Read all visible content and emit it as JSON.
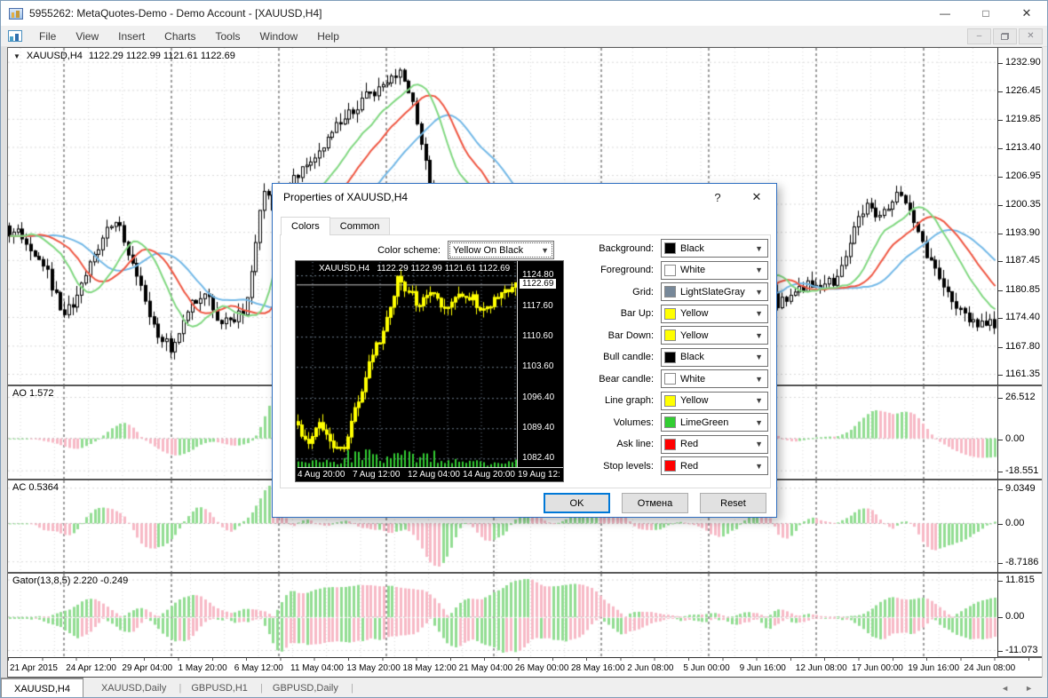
{
  "window": {
    "title": "5955262: MetaQuotes-Demo - Demo Account - [XAUUSD,H4]",
    "controls": {
      "minimize": "—",
      "maximize": "□",
      "close": "✕"
    }
  },
  "menu": {
    "items": [
      "File",
      "View",
      "Insert",
      "Charts",
      "Tools",
      "Window",
      "Help"
    ],
    "mdi": {
      "minimize": "–",
      "close": "✕"
    }
  },
  "chart": {
    "dropdown_arrow": "▼",
    "symbol_label": "XAUUSD,H4",
    "ohlc": "1122.29 1122.99 1121.61 1122.69",
    "price_ticks": [
      "1232.90",
      "1226.45",
      "1219.85",
      "1213.40",
      "1206.95",
      "1200.35",
      "1193.90",
      "1187.45",
      "1180.85",
      "1174.40",
      "1167.80",
      "1161.35"
    ],
    "time_ticks": [
      "21 Apr 2015",
      "24 Apr 12:00",
      "29 Apr 04:00",
      "1 May 20:00",
      "6 May 12:00",
      "11 May 04:00",
      "13 May 20:00",
      "18 May 12:00",
      "21 May 04:00",
      "26 May 00:00",
      "28 May 16:00",
      "2 Jun 08:00",
      "5 Jun 00:00",
      "9 Jun 16:00",
      "12 Jun 08:00",
      "17 Jun 00:00",
      "19 Jun 16:00",
      "24 Jun 08:00"
    ]
  },
  "indicators": [
    {
      "label": "AO 1.572",
      "ticks": [
        "26.512",
        "0.00",
        "-18.551"
      ]
    },
    {
      "label": "AC 0.5364",
      "ticks": [
        "9.0349",
        "0.00",
        "-8.7186"
      ]
    },
    {
      "label": "Gator(13,8,5) 2.220 -0.249",
      "ticks": [
        "11.815",
        "0.00",
        "-11.073"
      ]
    }
  ],
  "tabbar": {
    "tabs": [
      {
        "label": "XAUUSD,H4",
        "active": true
      },
      {
        "label": "XAUUSD,Daily"
      },
      {
        "label": "GBPUSD,H1"
      },
      {
        "label": "GBPUSD,Daily"
      }
    ],
    "scroll_left": "◄",
    "scroll_right": "►"
  },
  "dialog": {
    "title": "Properties of XAUUSD,H4",
    "help": "?",
    "close": "✕",
    "tabs": [
      {
        "label": "Colors",
        "active": true
      },
      {
        "label": "Common"
      }
    ],
    "color_scheme_label": "Color scheme:",
    "color_scheme_value": "Yellow On Black",
    "preview": {
      "symbol_label": "XAUUSD,H4",
      "ohlc": "1122.29 1122.99 1121.61 1122.69",
      "price_ticks": [
        {
          "v": "1124.80"
        },
        {
          "v": "1122.69",
          "current": true
        },
        {
          "v": "1117.60"
        },
        {
          "v": "1110.60"
        },
        {
          "v": "1103.60"
        },
        {
          "v": "1096.40"
        },
        {
          "v": "1089.40"
        },
        {
          "v": "1082.40"
        }
      ],
      "time_ticks": [
        "4 Aug 20:00",
        "7 Aug 12:00",
        "12 Aug 04:00",
        "14 Aug 20:00",
        "19 Aug 12:"
      ]
    },
    "rows": [
      {
        "label": "Background:",
        "value": "Black",
        "hex": "#000000"
      },
      {
        "label": "Foreground:",
        "value": "White",
        "hex": "#ffffff"
      },
      {
        "label": "Grid:",
        "value": "LightSlateGray",
        "hex": "#778899"
      },
      {
        "label": "Bar Up:",
        "value": "Yellow",
        "hex": "#ffff00"
      },
      {
        "label": "Bar Down:",
        "value": "Yellow",
        "hex": "#ffff00"
      },
      {
        "label": "Bull candle:",
        "value": "Black",
        "hex": "#000000"
      },
      {
        "label": "Bear candle:",
        "value": "White",
        "hex": "#ffffff"
      },
      {
        "label": "Line graph:",
        "value": "Yellow",
        "hex": "#ffff00"
      },
      {
        "label": "Volumes:",
        "value": "LimeGreen",
        "hex": "#32cd32"
      },
      {
        "label": "Ask line:",
        "value": "Red",
        "hex": "#ff0000"
      },
      {
        "label": "Stop levels:",
        "value": "Red",
        "hex": "#ff0000"
      }
    ],
    "buttons": [
      {
        "label": "OK",
        "default": true
      },
      {
        "label": "Отмена"
      },
      {
        "label": "Reset"
      }
    ]
  },
  "chart_data": {
    "type": "candlestick",
    "main": {
      "ylim": [
        1159.0,
        1236.2
      ],
      "bars": 233,
      "seed": 4242,
      "noise": 3.0,
      "wick": 2.2,
      "grid_step": 38.3,
      "separator_start": 63,
      "separator_step": 121,
      "anchors": [
        [
          0,
          1195
        ],
        [
          0.015,
          1193
        ],
        [
          0.04,
          1186
        ],
        [
          0.06,
          1175
        ],
        [
          0.075,
          1180
        ],
        [
          0.1,
          1193
        ],
        [
          0.115,
          1197
        ],
        [
          0.13,
          1185
        ],
        [
          0.155,
          1170
        ],
        [
          0.17,
          1167
        ],
        [
          0.185,
          1176
        ],
        [
          0.2,
          1181
        ],
        [
          0.215,
          1175
        ],
        [
          0.23,
          1172
        ],
        [
          0.245,
          1178
        ],
        [
          0.26,
          1203
        ],
        [
          0.275,
          1198
        ],
        [
          0.29,
          1205
        ],
        [
          0.305,
          1210
        ],
        [
          0.32,
          1213
        ],
        [
          0.335,
          1218
        ],
        [
          0.35,
          1221
        ],
        [
          0.37,
          1226
        ],
        [
          0.385,
          1229
        ],
        [
          0.4,
          1232
        ],
        [
          0.41,
          1226
        ],
        [
          0.42,
          1215
        ],
        [
          0.43,
          1205
        ],
        [
          0.44,
          1199
        ],
        [
          0.45,
          1202
        ],
        [
          0.46,
          1199
        ],
        [
          0.47,
          1192
        ],
        [
          0.49,
          1180
        ],
        [
          0.505,
          1175
        ],
        [
          0.52,
          1178
        ],
        [
          0.535,
          1172
        ],
        [
          0.55,
          1167
        ],
        [
          0.565,
          1164
        ],
        [
          0.58,
          1173
        ],
        [
          0.595,
          1179
        ],
        [
          0.61,
          1186
        ],
        [
          0.625,
          1184
        ],
        [
          0.64,
          1181
        ],
        [
          0.655,
          1180
        ],
        [
          0.67,
          1182
        ],
        [
          0.685,
          1184
        ],
        [
          0.7,
          1182
        ],
        [
          0.715,
          1179
        ],
        [
          0.73,
          1176
        ],
        [
          0.745,
          1181
        ],
        [
          0.755,
          1189
        ],
        [
          0.77,
          1183
        ],
        [
          0.78,
          1177
        ],
        [
          0.795,
          1180
        ],
        [
          0.81,
          1182
        ],
        [
          0.825,
          1181
        ],
        [
          0.84,
          1183
        ],
        [
          0.855,
          1193
        ],
        [
          0.87,
          1200
        ],
        [
          0.885,
          1198
        ],
        [
          0.9,
          1203
        ],
        [
          0.915,
          1199
        ],
        [
          0.93,
          1189
        ],
        [
          0.945,
          1183
        ],
        [
          0.96,
          1177
        ],
        [
          0.975,
          1173
        ],
        [
          0.99,
          1174
        ],
        [
          1,
          1173
        ]
      ]
    },
    "alligator": {
      "jaw": [
        13,
        8
      ],
      "teeth": [
        8,
        5
      ],
      "lips": [
        5,
        3
      ]
    },
    "panels": [
      {
        "tick_fracs": [
          0.12,
          0.565,
          0.915
        ]
      },
      {
        "tick_fracs": [
          0.085,
          0.47,
          0.89
        ]
      },
      {
        "tick_fracs": [
          0.075,
          0.52,
          0.92
        ]
      }
    ],
    "preview": {
      "ylim": [
        1080.3,
        1128.0
      ],
      "bars": 62,
      "seed": 777,
      "noise": 2.4,
      "wick": 2.0,
      "grid_step": 38,
      "current_price": 1122.69,
      "anchors": [
        [
          0,
          1091
        ],
        [
          0.06,
          1086
        ],
        [
          0.12,
          1091
        ],
        [
          0.17,
          1085
        ],
        [
          0.22,
          1084
        ],
        [
          0.28,
          1095
        ],
        [
          0.34,
          1104
        ],
        [
          0.4,
          1112
        ],
        [
          0.47,
          1124
        ],
        [
          0.52,
          1121
        ],
        [
          0.56,
          1118
        ],
        [
          0.62,
          1121
        ],
        [
          0.67,
          1116
        ],
        [
          0.72,
          1119
        ],
        [
          0.78,
          1121
        ],
        [
          0.84,
          1117
        ],
        [
          0.9,
          1119
        ],
        [
          1,
          1122.7
        ]
      ]
    },
    "colors": {
      "grid": "#d9d9d9",
      "grid_dark": "#3c3c3c",
      "ma_blue": "#74b9e7",
      "ma_red": "#ef5844",
      "ma_green": "#82d882",
      "hist_green": "#93dd93",
      "hist_pink": "#f7b9c6",
      "candle_stroke": "#000000",
      "bull_fill": "#ffffff",
      "bear_fill": "#000000",
      "preview_candle": "#ffff00",
      "preview_volume": "#32cd32",
      "preview_grid": "#6f7f8f",
      "preview_price_line": "#c8c8c8"
    }
  }
}
